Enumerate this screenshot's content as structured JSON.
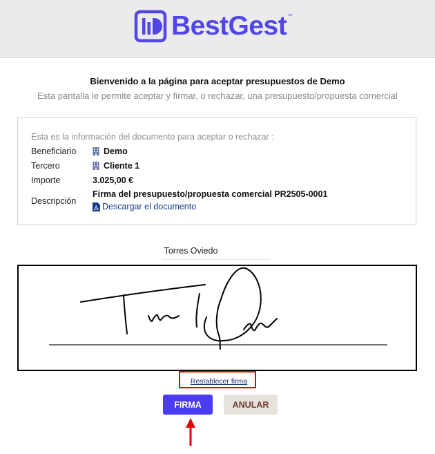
{
  "header": {
    "logo_text": "BestGest",
    "logo_tm": "™",
    "brand_color": "#5246e6"
  },
  "intro": {
    "welcome": "Bienvenido a la página para aceptar presupuestos de Demo",
    "subtitle": "Esta pantalla le permite aceptar y firmar, o rechazar, una presupuesto/propuesta comercial"
  },
  "document": {
    "intro": "Esta es la información del documento para aceptar o rechazar :",
    "beneficiario_label": "Beneficiario",
    "beneficiario_value": "Demo",
    "tercero_label": "Tercero",
    "tercero_value": "Cliente 1",
    "importe_label": "Importe",
    "importe_value": "3.025,00 €",
    "descripcion_label": "Descripción",
    "descripcion_value": "Firma del presupuesto/propuesta comercial PR2505-0001",
    "download_label": "Descargar el documento"
  },
  "signature": {
    "signer_name": "Torres Oviedo",
    "reset_label": "Restablecer firma"
  },
  "actions": {
    "sign_label": "FIRMA",
    "cancel_label": "ANULAR",
    "sign_color": "#4a3cf0",
    "highlight_color": "#e60000"
  }
}
